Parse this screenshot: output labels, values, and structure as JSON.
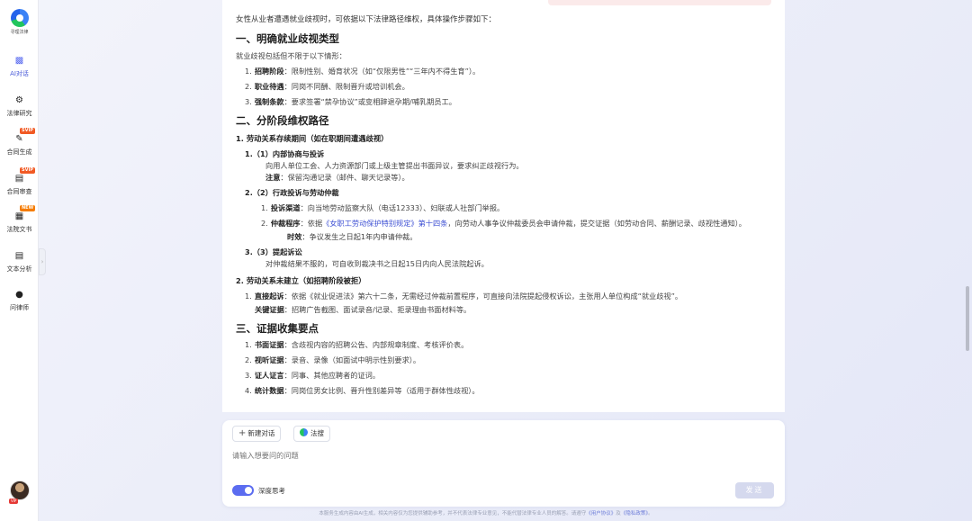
{
  "sidebar": {
    "logo_text": "寻理法律",
    "items": [
      {
        "label": "AI对话",
        "icon": "chat-icon",
        "badge": ""
      },
      {
        "label": "法律研究",
        "icon": "research-icon",
        "badge": ""
      },
      {
        "label": "合同生成",
        "icon": "contract-generate-icon",
        "badge": "SVIP"
      },
      {
        "label": "合同审查",
        "icon": "contract-review-icon",
        "badge": "SVIP"
      },
      {
        "label": "法院文书",
        "icon": "court-document-icon",
        "badge": "NEW"
      },
      {
        "label": "文本分析",
        "icon": "text-analysis-icon",
        "badge": ""
      },
      {
        "label": "问律师",
        "icon": "lawyer-icon",
        "badge": ""
      }
    ],
    "avatar_tag": "VIP"
  },
  "answer": {
    "intro": "女性从业者遭遇就业歧视时，可依据以下法律路径维权，具体操作步骤如下：",
    "s1_title": "一、明确就业歧视类型",
    "s1_lead": "就业歧视包括但不限于以下情形：",
    "s1_items": [
      {
        "num": "1.",
        "key": "招聘阶段",
        "text": "：限制性别、婚育状况（如“仅限男性”“三年内不得生育”）。"
      },
      {
        "num": "2.",
        "key": "职业待遇",
        "text": "：同岗不同酬、限制晋升或培训机会。"
      },
      {
        "num": "3.",
        "key": "强制条款",
        "text": "：要求签署“禁孕协议”或变相辞退孕期/哺乳期员工。"
      }
    ],
    "s2_title": "二、分阶段维权路径",
    "s2_p1": "1. 劳动关系存续期间（如在职期间遭遇歧视）",
    "s2_p1_a_title": "1.（1）内部协商与投诉",
    "s2_p1_a_body": "向用人单位工会、人力资源部门或上级主管提出书面异议，要求纠正歧视行为。",
    "s2_p1_a_note_key": "注意",
    "s2_p1_a_note": "：保留沟通记录（邮件、聊天记录等）。",
    "s2_p1_b_title": "2.（2）行政投诉与劳动仲裁",
    "s2_p1_b_i1_num": "1.",
    "s2_p1_b_i1_key": "投诉渠道",
    "s2_p1_b_i1_text": "：向当地劳动监察大队（电话12333）、妇联或人社部门举报。",
    "s2_p1_b_i2_num": "2.",
    "s2_p1_b_i2_key": "仲裁程序",
    "s2_p1_b_i2_pre": "：依据",
    "s2_p1_b_i2_link": "《女职工劳动保护特别规定》第十四条",
    "s2_p1_b_i2_post": "，向劳动人事争议仲裁委员会申请仲裁，提交证据（如劳动合同、薪酬记录、歧视性通知）。",
    "s2_p1_b_i2_time_key": "时效",
    "s2_p1_b_i2_time": "：争议发生之日起1年内申请仲裁。",
    "s2_p1_c_title": "3.（3）提起诉讼",
    "s2_p1_c_body": "对仲裁结果不服的，可自收到裁决书之日起15日内向人民法院起诉。",
    "s2_p2": "2. 劳动关系未建立（如招聘阶段被拒）",
    "s2_p2_i1_num": "1.",
    "s2_p2_i1_key": "直接起诉",
    "s2_p2_i1_text": "：依据《就业促进法》第六十二条，无需经过仲裁前置程序，可直接向法院提起侵权诉讼，主张用人单位构成“就业歧视”。",
    "s2_p2_i1_ev_key": "关键证据",
    "s2_p2_i1_ev": "：招聘广告截图、面试录音/记录、拒录理由书面材料等。",
    "s3_title": "三、证据收集要点",
    "s3_items": [
      {
        "num": "1.",
        "key": "书面证据",
        "text": "：含歧视内容的招聘公告、内部规章制度、考核评价表。"
      },
      {
        "num": "2.",
        "key": "视听证据",
        "text": "：录音、录像（如面试中明示性别要求）。"
      },
      {
        "num": "3.",
        "key": "证人证言",
        "text": "：同事、其他应聘者的证词。"
      },
      {
        "num": "4.",
        "key": "统计数据",
        "text": "：同岗位男女比例、晋升性别差异等（适用于群体性歧视）。"
      }
    ]
  },
  "composer": {
    "new_chat_label": "新建对话",
    "search_label": "法搜",
    "placeholder": "请输入想要问的问题",
    "deep_think_label": "深度思考",
    "deep_think_on": true,
    "send_label": "发送"
  },
  "footer": {
    "text": "本服务生成内容由AI生成，相关内容仅为您提供辅助参考，并不代表法律专业意见，不能代替法律专业人员的解答。请遵守",
    "link1": "《用户协议》",
    "and": "及",
    "link2": "《隐私政策》",
    "end": "。"
  },
  "colors": {
    "accent": "#5b6cf0",
    "link": "#3f51d4",
    "svip_badge": "#f15a24",
    "new_badge": "#f57c00",
    "send_disabled": "#d5d9ee"
  }
}
